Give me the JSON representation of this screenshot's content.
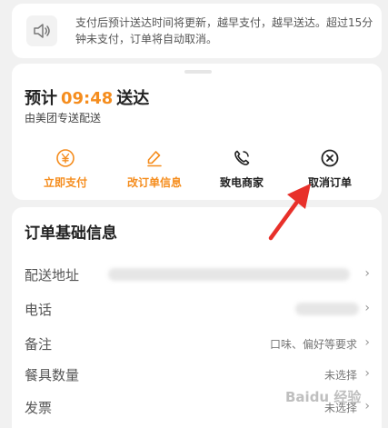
{
  "notice": {
    "icon": "speaker-icon",
    "text": "支付后预计送达时间将更新，越早支付，越早送达。超过15分钟未支付，订单将自动取消。"
  },
  "status": {
    "eta_prefix": "预计",
    "eta_time": "09:48",
    "eta_suffix": "送达",
    "delivery_by": "由美团专送配送",
    "actions": [
      {
        "label": "立即支付",
        "icon": "yen-icon"
      },
      {
        "label": "改订单信息",
        "icon": "pencil-icon"
      },
      {
        "label": "致电商家",
        "icon": "phone-icon"
      },
      {
        "label": "取消订单",
        "icon": "cancel-icon"
      }
    ]
  },
  "info": {
    "title": "订单基础信息",
    "rows": [
      {
        "label": "配送地址",
        "value": ""
      },
      {
        "label": "电话",
        "value": ""
      },
      {
        "label": "备注",
        "value": "口味、偏好等要求"
      },
      {
        "label": "餐具数量",
        "value": "未选择"
      },
      {
        "label": "发票",
        "value": "未选择"
      }
    ]
  },
  "colors": {
    "accent": "#f58d1e",
    "annotation": "#e8302a"
  }
}
